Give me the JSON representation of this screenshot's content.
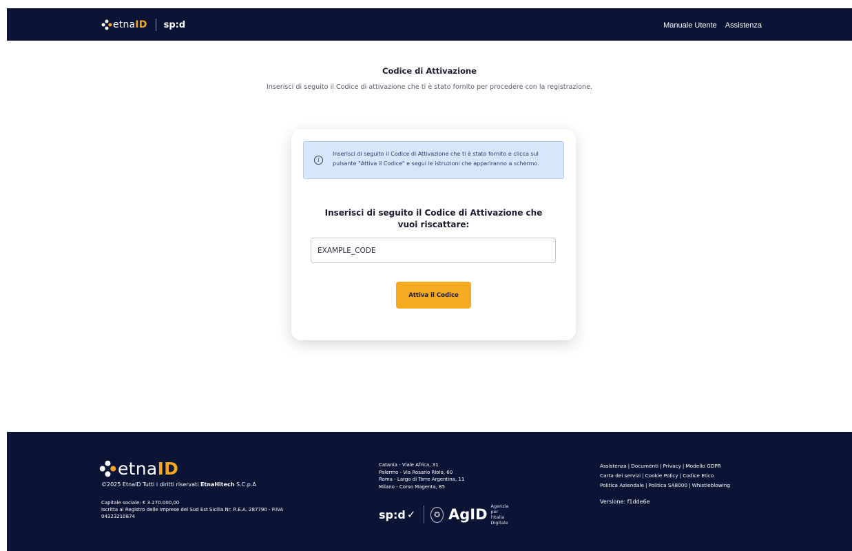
{
  "header": {
    "brand_etna": "etna",
    "brand_id": "ID",
    "brand_spid": "sp:d",
    "nav": [
      "Manuale Utente",
      "Assistenza"
    ]
  },
  "page": {
    "title": "Codice di Attivazione",
    "subtitle": "Inserisci di seguito il Codice di attivazione che ti è stato fornito per procedere con la registrazione."
  },
  "card": {
    "info_text": "Inserisci di seguito il Codice di Attivazione che ti è stato fornito e clicca sul pulsante \"Attiva il Codice\" e segui le istruzioni che appariranno a schermo.",
    "form_title": "Inserisci di seguito il Codice di Attivazione che vuoi riscattare:",
    "input_value": "EXAMPLE_CODE",
    "button_label": "Attiva il Codice"
  },
  "footer": {
    "logo_etna": "etna",
    "logo_id": "ID",
    "copyright_prefix": "©2025 EtnaID Tutti i diritti riservati ",
    "copyright_company": "EtnaHitech",
    "copyright_suffix": " S.C.p.A",
    "capital": "Capitale sociale: € 3.270.000,00",
    "registry": "Iscritta al Registro delle Imprese del Sud Est Sicilia Nr. R.E.A. 287790 - P.IVA 04323210874",
    "addresses": [
      "Catania - Viale Africa, 31",
      "Palermo - Via Rosario Riolo, 60",
      "Roma - Largo di Torre Argentina, 11",
      "Milano - Corso Magenta, 85"
    ],
    "spid_badge": "sp:d",
    "agid_label": "AgID",
    "agid_sub_1": "Agenzia per",
    "agid_sub_2": "l'Italia Digitale",
    "links_row1": [
      "Assistenza",
      "Documenti",
      "Privacy",
      "Modello GDPR"
    ],
    "links_row2": [
      "Carta dei servizi",
      "Cookie Policy",
      "Codice Etico"
    ],
    "links_row3": [
      "Politica Aziendale",
      "Politica SA8000",
      "Whistleblowing"
    ],
    "version": "Versione: f1dde6e"
  },
  "colors": {
    "navy": "#0c1436",
    "accent_orange": "#f5ab21",
    "info_blue": "#d8e6fb"
  },
  "icons": [
    "etnaid-logo-icon",
    "info-icon",
    "spid-check-icon",
    "republic-emblem-icon"
  ]
}
